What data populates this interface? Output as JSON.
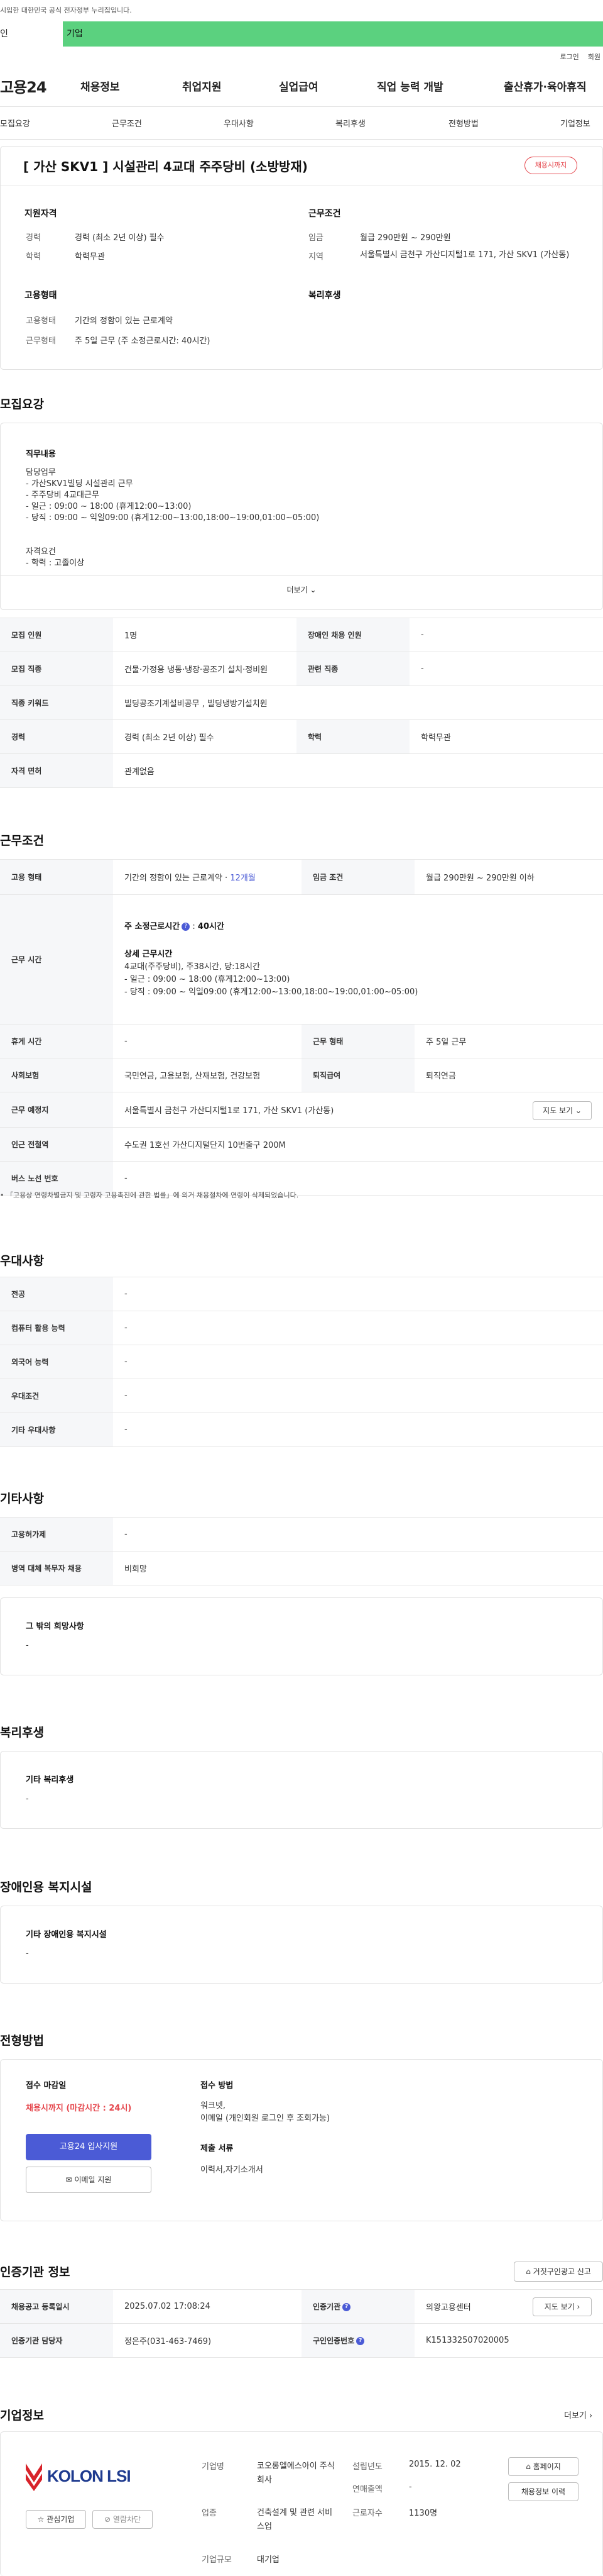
{
  "header": {
    "gov_notice": "시입한 대한민국 공식 전자정부 누리집입니다.",
    "tab_active": "인",
    "tab_other": "기업",
    "login": "로그인",
    "join": "회원",
    "logo": "고용24",
    "menu": [
      "채용정보",
      "취업지원",
      "실업급여",
      "직업 능력 개발",
      "출산휴가·육아휴직"
    ]
  },
  "subnav": [
    "모집요강",
    "근무조건",
    "우대사항",
    "복리후생",
    "전형방법",
    "기업정보"
  ],
  "summary": {
    "title": "[ 가산 SKV1 ] 시설관리 4교대 주주당비 (소방방재)",
    "status": "채용시까지",
    "qualify_title": "지원자격",
    "work_title": "근무조건",
    "career_label": "경력",
    "career_value": "경력 (최소 2년 이상) 필수",
    "edu_label": "학력",
    "edu_value": "학력무관",
    "wage_label": "임금",
    "wage_value": "월급 290만원 ~ 290만원",
    "region_label": "지역",
    "region_value": "서울특별시 금천구 가산디지털1로 171, 가산 SKV1 (가산동)",
    "emp_title": "고용형태",
    "welfare_title": "복리후생",
    "emptype_label": "고용형태",
    "emptype_value": "기간의 정함이 있는 근로계약",
    "worktype_label": "근무형태",
    "worktype_value": "주 5일 근무 (주 소정근로시간: 40시간)"
  },
  "recruit": {
    "title": "모집요강",
    "job_title": "직무내용",
    "job_lines": [
      "담당업무",
      "- 가산SKV1빌딩 시설관리 근무",
      "- 주주당비 4교대근무",
      "- 일근 : 09:00 ~ 18:00 (휴게12:00~13:00)",
      "- 당직 : 09:00 ~ 익일09:00 (휴게12:00~13:00,18:00~19:00,01:00~05:00)",
      "",
      "자격요건",
      "- 학력 : 고졸이상"
    ],
    "more": "더보기",
    "rows": [
      {
        "l1": "모집 인원",
        "v1": "1명",
        "l2": "장애인 채용 인원",
        "v2": "-"
      },
      {
        "l1": "모집 직종",
        "v1": "건물·가정용 냉동·냉장·공조기 설치·정비원",
        "l2": "관련 직종",
        "v2": "-"
      },
      {
        "l1": "직종 키워드",
        "v1": "빌딩공조기계설비공무 , 빌딩냉방기설치원"
      },
      {
        "l1": "경력",
        "v1": "경력 (최소 2년 이상) 필수",
        "l2": "학력",
        "v2": "학력무관"
      },
      {
        "l1": "자격 면허",
        "v1": "관계없음"
      }
    ]
  },
  "conditions": {
    "title": "근무조건",
    "emp_label": "고용 형태",
    "emp_value": "기간의 정함이 있는 근로계약 · ",
    "emp_months": "12개월",
    "wage_label": "임금 조건",
    "wage_value": "월급 290만원 ~ 290만원 이하",
    "hours_label": "근무 시간",
    "hours_week": "주 소정근로시간",
    "hours_week_value": "40시간",
    "hours_detail_title": "상세 근무시간",
    "hours_lines": [
      "4교대(주주당비), 주38시간, 당:18시간",
      "- 일근 : 09:00 ~ 18:00 (휴게12:00~13:00)",
      "- 당직 : 09:00 ~ 익일09:00 (휴게12:00~13:00,18:00~19:00,01:00~05:00)"
    ],
    "rest_label": "휴게 시간",
    "rest_value": "-",
    "worktype_label": "근무 형태",
    "worktype_value": "주 5일 근무",
    "insurance_label": "사회보험",
    "insurance_value": "국민연금, 고용보험, 산재보험, 건강보험",
    "retire_label": "퇴직급여",
    "retire_value": "퇴직연금",
    "place_label": "근무 예정지",
    "place_value": "서울특별시 금천구 가산디지털1로 171, 가산 SKV1 (가산동)",
    "map_btn": "지도 보기",
    "subway_label": "인근 전철역",
    "subway_value": "수도권 1호선 가산디지털단지 10번출구 200M",
    "bus_label": "버스 노선 번호",
    "bus_value": "-",
    "notice": "「고용상 연령차별금지 및 고령자 고용촉진에 관한 법률」에 의거 채용절차에 연령이 삭제되었습니다."
  },
  "preference": {
    "title": "우대사항",
    "rows": [
      [
        "전공",
        "-"
      ],
      [
        "컴퓨터 활용 능력",
        "-"
      ],
      [
        "외국어 능력",
        "-"
      ],
      [
        "우대조건",
        "-"
      ],
      [
        "기타 우대사항",
        "-"
      ]
    ]
  },
  "other": {
    "title": "기타사항",
    "rows": [
      [
        "고용허가제",
        "-"
      ],
      [
        "병역 대체 복무자 채용",
        "비희망"
      ]
    ],
    "wish_title": "그 밖의 희망사항",
    "wish_value": "-"
  },
  "welfare": {
    "title": "복리후생",
    "card_title": "기타 복리후생",
    "card_value": "-"
  },
  "disabled": {
    "title": "장애인용 복지시설",
    "card_title": "기타 장애인용 복지시설",
    "card_value": "-"
  },
  "selection": {
    "title": "전형방법",
    "deadline_title": "접수 마감일",
    "deadline_value": "채용시까지 (마감시간 : 24시)",
    "apply_btn": "고용24 입사지원",
    "email_btn": "이메일 지원",
    "method_title": "접수 방법",
    "method_lines": [
      "워크넷,",
      "이메일 (개인회원 로그인 후 조회가능)"
    ],
    "docs_title": "제출 서류",
    "docs_value": "이력서,자기소개서"
  },
  "cert": {
    "title": "인증기관 정보",
    "report_btn": "거짓구인광고 신고",
    "reg_label": "채용공고 등록일시",
    "reg_value": "2025.07.02 17:08:24",
    "org_label": "인증기관",
    "org_value": "의왕고용센터",
    "map_btn": "지도 보기",
    "mgr_label": "인증기관 담당자",
    "mgr_value": "정은주(031-463-7469)",
    "num_label": "구인인증번호",
    "num_value": "K151332507020005"
  },
  "company": {
    "title": "기업정보",
    "more": "더보기",
    "logo_text": "KOLON LSI",
    "fav_btn": "관심기업",
    "block_btn": "열람차단",
    "name_label": "기업명",
    "name_value": "코오롱엘에스아이 주식회사",
    "founded_label": "설립년도",
    "founded_value": "2015. 12. 02",
    "industry_label": "업종",
    "industry_value": "건축설계 및 관련 서비스업",
    "sales_label": "연매출액",
    "sales_value": "-",
    "emp_label": "근로자수",
    "emp_value": "1130명",
    "size_label": "기업규모",
    "size_value": "대기업",
    "home_btn": "홈페이지",
    "jobs_btn": "채용정보 이력"
  },
  "colors": {
    "green": "#5bd17f",
    "blue": "#4b5bd6",
    "red": "#e5464c"
  }
}
